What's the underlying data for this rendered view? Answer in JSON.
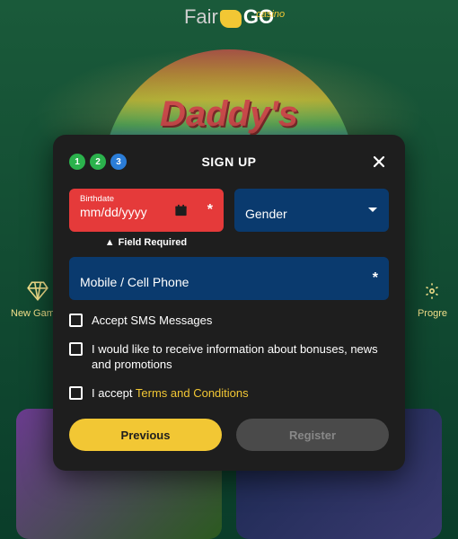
{
  "logo": {
    "left": "Fair",
    "right": "GO",
    "sub": "casino"
  },
  "hero_title": "Daddy's",
  "categories": {
    "left": "New Games",
    "right": "Progre"
  },
  "modal": {
    "title": "SIGN UP",
    "steps": [
      "1",
      "2",
      "3"
    ],
    "birthdate": {
      "label": "Birthdate",
      "value": "mm/dd/yyyy"
    },
    "gender": {
      "placeholder": "Gender"
    },
    "phone": {
      "placeholder": "Mobile / Cell Phone"
    },
    "error": "Field Required",
    "check_sms": "Accept SMS Messages",
    "check_promo": "I would like to receive information about bonuses, news and promotions",
    "check_terms_prefix": "I accept ",
    "check_terms_link": "Terms and Conditions",
    "btn_prev": "Previous",
    "btn_register": "Register"
  }
}
